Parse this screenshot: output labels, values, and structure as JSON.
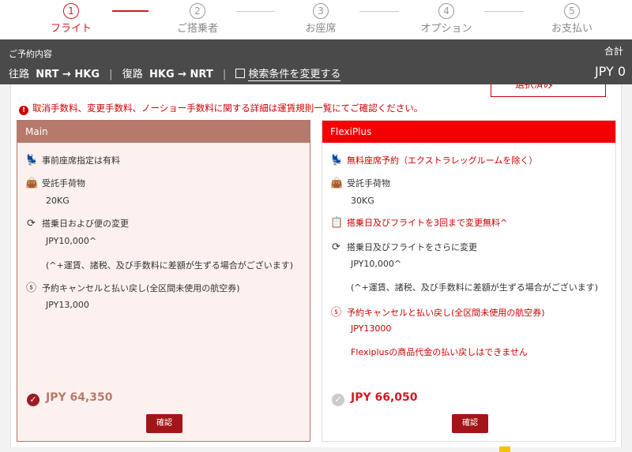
{
  "stepper": {
    "steps": [
      {
        "num": "1",
        "label": "フライト"
      },
      {
        "num": "2",
        "label": "ご搭乗者"
      },
      {
        "num": "3",
        "label": "お座席"
      },
      {
        "num": "4",
        "label": "オプション"
      },
      {
        "num": "5",
        "label": "お支払い"
      }
    ],
    "active_index": 0
  },
  "summary": {
    "title": "ご予約内容",
    "outbound_label": "往路",
    "outbound_route": "NRT → HKG",
    "return_label": "復路",
    "return_route": "HKG → NRT",
    "edit_label": "検索条件を変更する",
    "total_label": "合計",
    "total_value": "JPY 0"
  },
  "selected_tab_label": "選択済み",
  "notice": "取消手数料、変更手数料、ノーショー手数料に関する詳細は運賃規則一覧にてご確認ください。",
  "cards": {
    "main": {
      "name": "Main",
      "seat": "事前座席指定は有料",
      "baggage_label": "受託手荷物",
      "baggage_value": "20KG",
      "change_label": "搭乗日および便の変更",
      "change_fee": "JPY10,000^",
      "change_note": "(^+運賃、諸税、及び手数料に差額が生ずる場合がございます)",
      "refund_label": "予約キャンセルと払い戻し(全区間未使用の航空券)",
      "refund_value": "JPY13,000",
      "price": "JPY 64,350",
      "confirm": "確認"
    },
    "flexi": {
      "name": "FlexiPlus",
      "seat": "無料座席予約（エクストラレッグルームを除く）",
      "baggage_label": "受託手荷物",
      "baggage_value": "30KG",
      "free_change": "搭乗日及びフライトを3回まで変更無料^",
      "change_label": "搭乗日及びフライトをさらに変更",
      "change_fee": "JPY10,000^",
      "change_note": "(^+運賃、諸税、及び手数料に差額が生ずる場合がございます)",
      "refund_label": "予約キャンセルと払い戻し(全区間未使用の航空券)",
      "refund_value": "JPY13000",
      "refund_note": "Flexiplusの商品代金の払い戻しはできません",
      "price": "JPY 66,050",
      "confirm": "確認"
    }
  },
  "colors": {
    "brand_red": "#d71920",
    "main_header": "#b67a6d",
    "flexi_header": "#f50000",
    "summary_bg": "#4a4a4a"
  }
}
